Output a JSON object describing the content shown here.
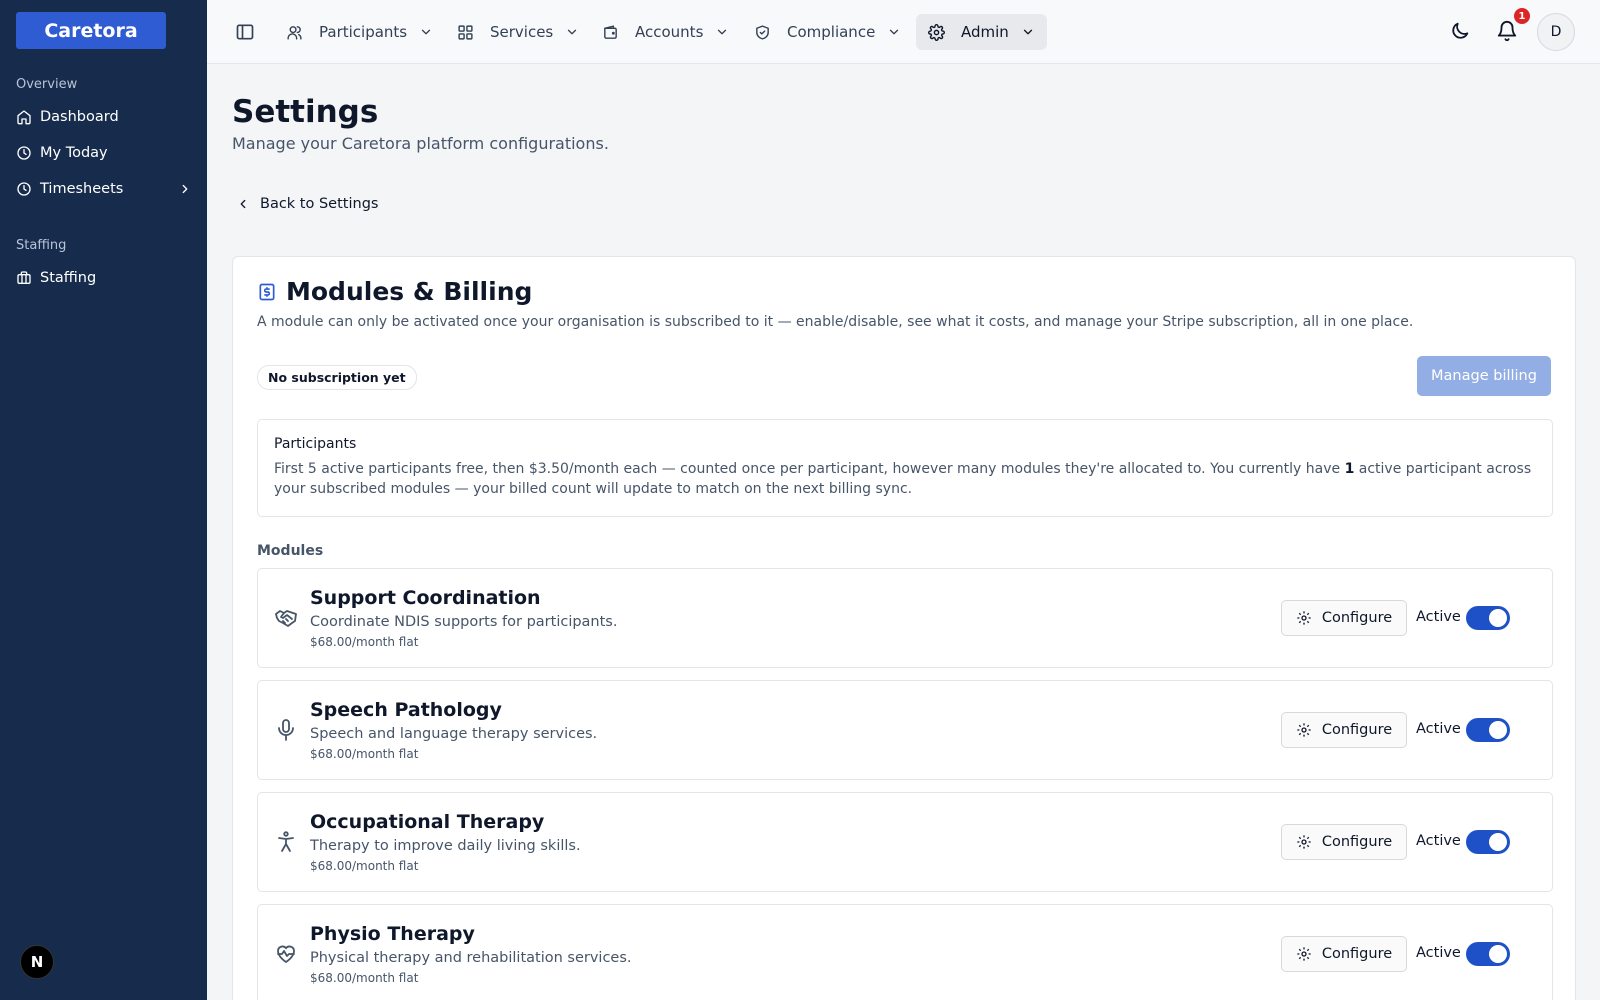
{
  "brand": "Caretora",
  "sidebar": {
    "sections": [
      {
        "title": "Overview",
        "items": [
          {
            "label": "Dashboard",
            "icon": "home-icon"
          },
          {
            "label": "My Today",
            "icon": "clock-icon"
          },
          {
            "label": "Timesheets",
            "icon": "clock-icon",
            "expandable": true
          }
        ]
      },
      {
        "title": "Staffing",
        "items": [
          {
            "label": "Staffing",
            "icon": "briefcase-icon"
          }
        ]
      }
    ],
    "footer_badge": "N"
  },
  "topbar": {
    "nav": [
      {
        "label": "Participants",
        "icon": "users-icon"
      },
      {
        "label": "Services",
        "icon": "grid-icon"
      },
      {
        "label": "Accounts",
        "icon": "wallet-icon"
      },
      {
        "label": "Compliance",
        "icon": "shield-check-icon"
      },
      {
        "label": "Admin",
        "icon": "gear-icon",
        "active": true
      }
    ],
    "notification_count": "1",
    "avatar_initial": "D"
  },
  "page": {
    "title": "Settings",
    "subtitle": "Manage your Caretora platform configurations.",
    "back_label": "Back to Settings"
  },
  "billing": {
    "title": "Modules & Billing",
    "description": "A module can only be activated once your organisation is subscribed to it — enable/disable, see what it costs, and manage your Stripe subscription, all in one place.",
    "subscription_status": "No subscription yet",
    "manage_label": "Manage billing",
    "info": {
      "title": "Participants",
      "text_before": "First 5 active participants free, then $3.50/month each — counted once per participant, however many modules they're allocated to. You currently have ",
      "active_count": "1",
      "text_after": " active participant across your subscribed modules — your billed count will update to match on the next billing sync."
    },
    "modules_label": "Modules",
    "configure_label": "Configure",
    "active_label": "Active",
    "modules": [
      {
        "name": "Support Coordination",
        "description": "Coordinate NDIS supports for participants.",
        "price": "$68.00/month flat",
        "icon": "handshake-icon",
        "active": true
      },
      {
        "name": "Speech Pathology",
        "description": "Speech and language therapy services.",
        "price": "$68.00/month flat",
        "icon": "microphone-icon",
        "active": true
      },
      {
        "name": "Occupational Therapy",
        "description": "Therapy to improve daily living skills.",
        "price": "$68.00/month flat",
        "icon": "accessibility-icon",
        "active": true
      },
      {
        "name": "Physio Therapy",
        "description": "Physical therapy and rehabilitation services.",
        "price": "$68.00/month flat",
        "icon": "heart-pulse-icon",
        "active": true
      }
    ]
  },
  "colors": {
    "sidebar_bg": "#172b4d",
    "brand_blue": "#2f5bd3",
    "toggle_on": "#1e50c8",
    "manage_btn_disabled": "#93aee4",
    "notification_red": "#dc2626"
  }
}
